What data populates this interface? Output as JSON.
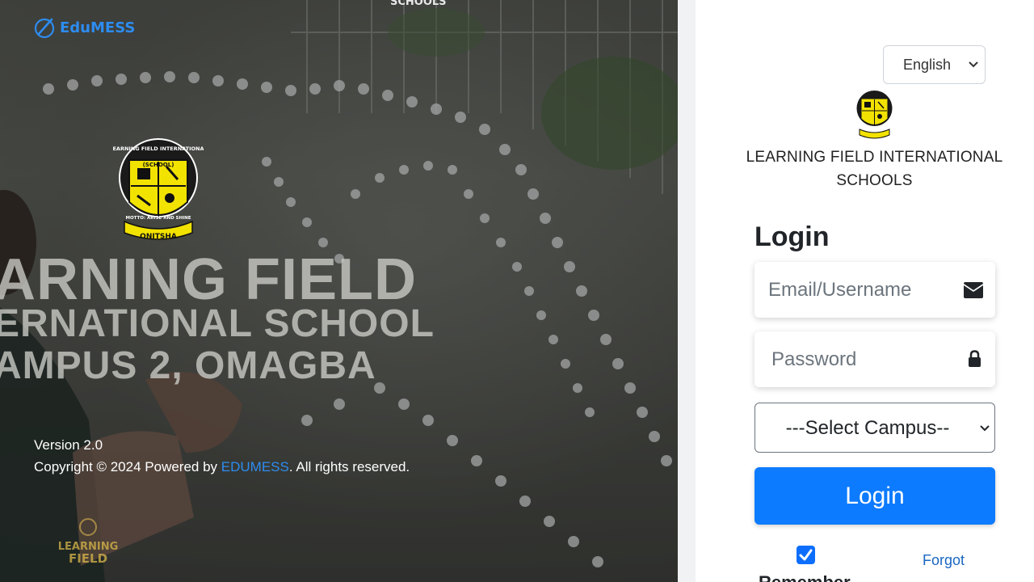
{
  "brand": {
    "name": "EduMESS"
  },
  "hero": {
    "top_text": "SCHOOLS",
    "line1": "ARNING FIELD",
    "line2": "ERNATIONAL SCHOOL",
    "line3": "AMPUS 2, OMAGBA",
    "crest_top": "LEARNING FIELD INTERNATIONAL",
    "crest_school": "(SCHOOL)",
    "crest_motto": "MOTTO: ARISE AND SHINE",
    "crest_city": "ONITSHA",
    "version": "Version 2.0",
    "copyright_prefix": "Copyright © 2024 Powered by ",
    "copyright_link": "EDUMESS",
    "copyright_suffix": ". All rights reserved.",
    "mini_logo_text1": "LEARNING",
    "mini_logo_text2": "FIELD"
  },
  "panel": {
    "language": "English",
    "school_name": "LEARNING FIELD INTERNATIONAL SCHOOLS",
    "login_title": "Login",
    "email_placeholder": "Email/Username",
    "password_placeholder": "Password",
    "campus_selected": "---Select Campus--",
    "login_button": "Login",
    "remember_label": "Remember",
    "remember_checked": true,
    "forgot_link": "Forgot"
  },
  "colors": {
    "accent": "#0d7bff",
    "brand_blue": "#2d8cf0",
    "crest_yellow": "#f2e200"
  },
  "icons": [
    "edumess-logo-icon",
    "envelope-icon",
    "lock-icon",
    "chevron-down-icon",
    "checkmark-icon"
  ]
}
